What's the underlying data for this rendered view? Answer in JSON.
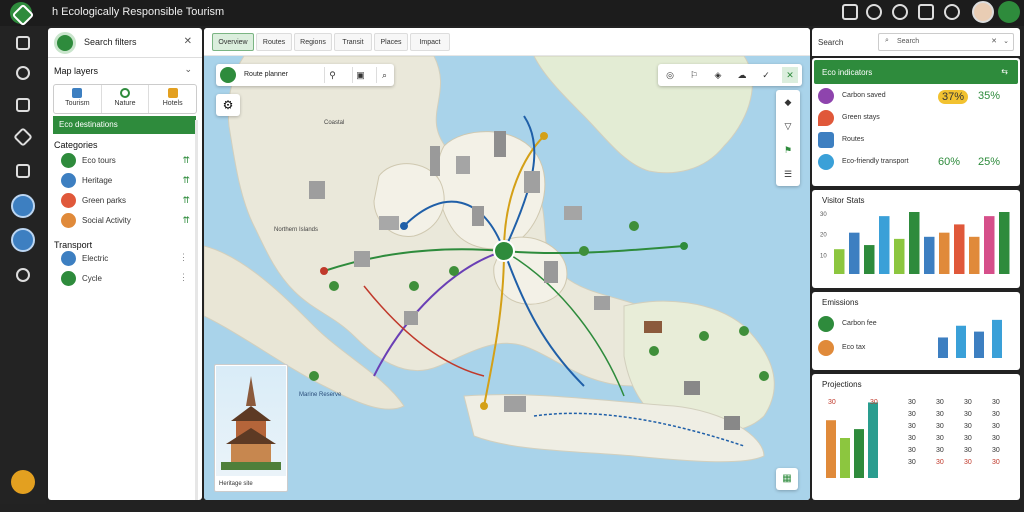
{
  "topbar": {
    "title": "h Ecologically Responsible Tourism"
  },
  "sidebar": {
    "header": "Search filters",
    "section_title": "Map layers",
    "tabs": [
      {
        "label": "Tourism",
        "icon": "home-icon",
        "color": "#3d7fc1"
      },
      {
        "label": "Nature",
        "icon": "location-icon",
        "color": "#2e8b3c"
      },
      {
        "label": "Hotels",
        "icon": "star-icon",
        "color": "#e3a020"
      }
    ],
    "highlight": "Eco destinations",
    "group1_title": "Categories",
    "group1": [
      {
        "label": "Eco tours",
        "color": "#2e8b3c"
      },
      {
        "label": "Heritage",
        "color": "#3d7fc1"
      },
      {
        "label": "Green parks",
        "color": "#e0583a"
      },
      {
        "label": "Social Activity",
        "color": "#e08a3a"
      }
    ],
    "group2_title": "Transport",
    "group2": [
      {
        "label": "Electric",
        "color": "#3d7fc1"
      },
      {
        "label": "Cycle",
        "color": "#2e8b3c"
      }
    ]
  },
  "map": {
    "tabs": [
      "Overview",
      "Routes",
      "Regions",
      "Transit",
      "Places",
      "Impact"
    ],
    "toolbar_label": "Route planner",
    "thumbnail_caption": "Heritage site",
    "map_labels": [
      "Coastal",
      "Northern Islands",
      "Marine Reserve"
    ]
  },
  "right": {
    "header_label": "Search",
    "search_value": "Search",
    "summary_title": "Eco indicators",
    "stats": [
      {
        "label": "Carbon saved",
        "v1": "37%",
        "v2": "35%",
        "color": "#8e44ad"
      },
      {
        "label": "Green stays",
        "v1": "",
        "v2": "",
        "color": "#e0583a"
      },
      {
        "label": "Routes",
        "v1": "",
        "v2": "",
        "color": "#3d7fc1"
      },
      {
        "label": "Eco-friendly transport",
        "v1": "60%",
        "v2": "25%",
        "color": "#3aa0d8"
      }
    ],
    "chart1_title": "Visitor Stats",
    "chart1_ticks": [
      "30",
      "20",
      "10"
    ],
    "chart2_title": "Emissions",
    "chart2_items": [
      {
        "label": "Carbon fee",
        "color": "#2e8b3c"
      },
      {
        "label": "Eco tax",
        "color": "#e08a3a"
      }
    ],
    "chart3_title": "Projections",
    "chart3_rows": [
      [
        "30",
        "30",
        "30",
        "30",
        "30"
      ],
      [
        "30",
        "30",
        "30",
        "30",
        "30"
      ],
      [
        "30",
        "30",
        "30",
        "30",
        "30"
      ],
      [
        "30",
        "30",
        "30",
        "30",
        "30"
      ],
      [
        "30",
        "30",
        "30",
        "30",
        "30"
      ],
      [
        "30",
        "30",
        "30",
        "30",
        "30"
      ]
    ]
  },
  "chart_data": [
    {
      "type": "bar",
      "title": "Visitor Stats",
      "values": [
        12,
        20,
        14,
        28,
        17,
        30,
        18,
        20,
        24,
        18,
        28,
        30
      ]
    },
    {
      "type": "bar",
      "title": "Emissions",
      "values": [
        14,
        22,
        18,
        26
      ]
    },
    {
      "type": "bar",
      "title": "Projections",
      "values": [
        26,
        18,
        22,
        34
      ]
    }
  ]
}
